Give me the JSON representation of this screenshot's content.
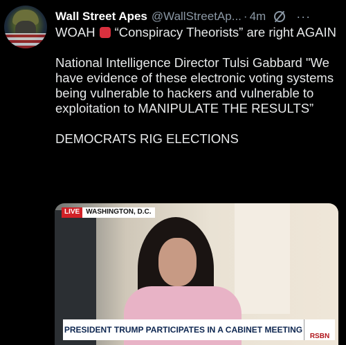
{
  "author": {
    "name": "Wall Street Apes",
    "handle": "@WallStreetAp...",
    "separator": "·",
    "time": "4m",
    "more_label": "···"
  },
  "tweet": {
    "line1_prefix": "WOAH",
    "line1_suffix": "“Conspiracy Theorists” are right AGAIN",
    "para2": "National Intelligence Director Tulsi Gabbard \"We have evidence of these electronic voting systems being vulnerable to hackers and vulnerable to exploitation to MANIPULATE THE RESULTS”",
    "para3": "DEMOCRATS RIG ELECTIONS"
  },
  "media": {
    "live_label": "LIVE",
    "location": "WASHINGTON, D.C.",
    "lower_third": "PRESIDENT TRUMP PARTICIPATES IN A CABINET MEETING",
    "network": "RSBN"
  }
}
